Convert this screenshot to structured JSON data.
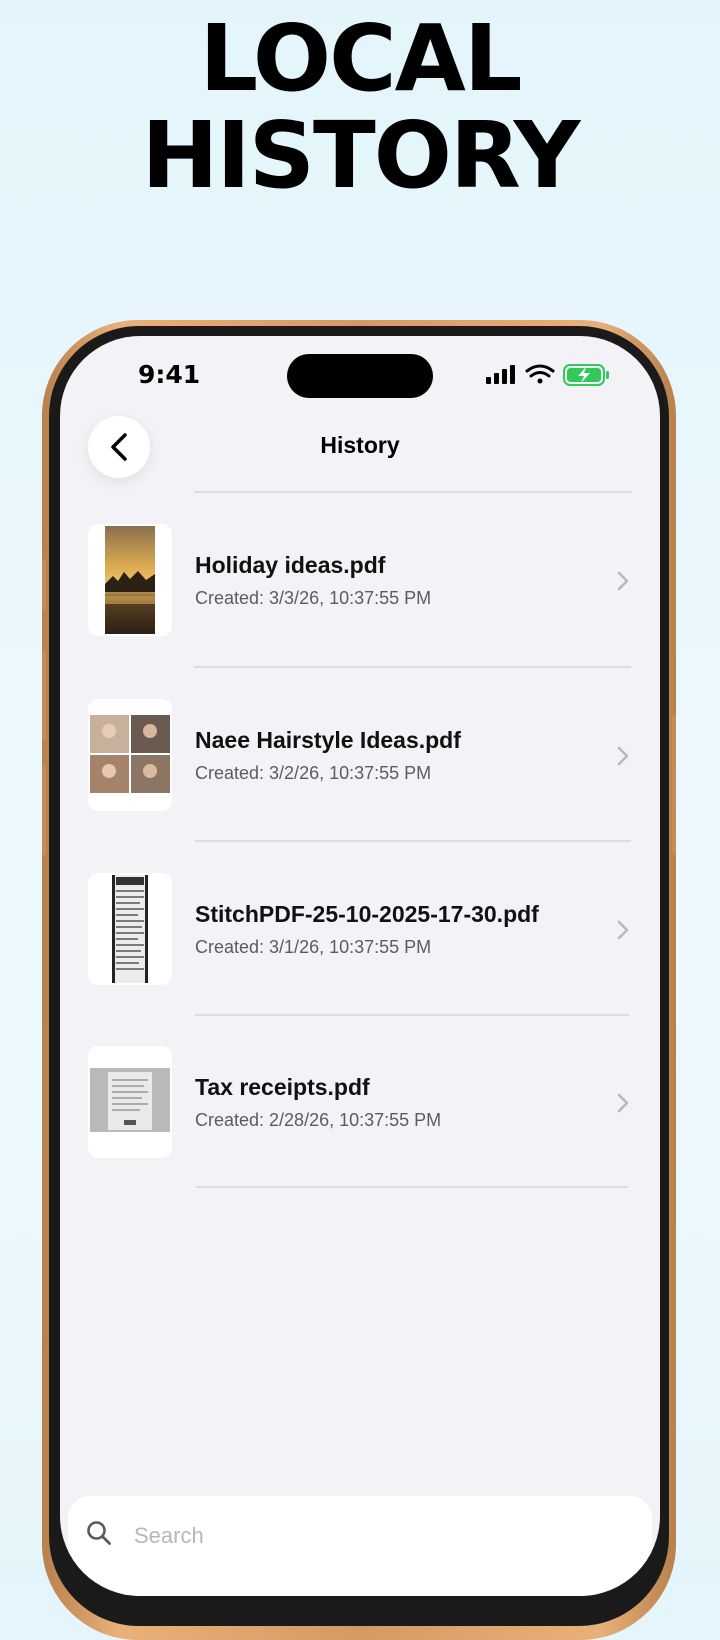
{
  "promo": {
    "headline_line1": "LOCAL",
    "headline_line2": "HISTORY"
  },
  "status_bar": {
    "time": "9:41"
  },
  "nav": {
    "title": "History"
  },
  "history": [
    {
      "title": "Holiday ideas.pdf",
      "created": "Created: 3/3/26, 10:37:55 PM"
    },
    {
      "title": "Naee Hairstyle Ideas.pdf",
      "created": "Created: 3/2/26, 10:37:55 PM"
    },
    {
      "title": "StitchPDF-25-10-2025-17-30.pdf",
      "created": "Created: 3/1/26, 10:37:55 PM"
    },
    {
      "title": "Tax receipts.pdf",
      "created": "Created: 2/28/26, 10:37:55 PM"
    }
  ],
  "search": {
    "placeholder": "Search"
  },
  "colors": {
    "background": "#e3f5fb",
    "screen": "#f3f2f7",
    "frame": "#d49a62",
    "battery": "#34c759"
  },
  "icons": [
    "back-chevron-icon",
    "cellular-signal-icon",
    "wifi-icon",
    "battery-charging-icon",
    "chevron-right-icon",
    "search-icon"
  ]
}
